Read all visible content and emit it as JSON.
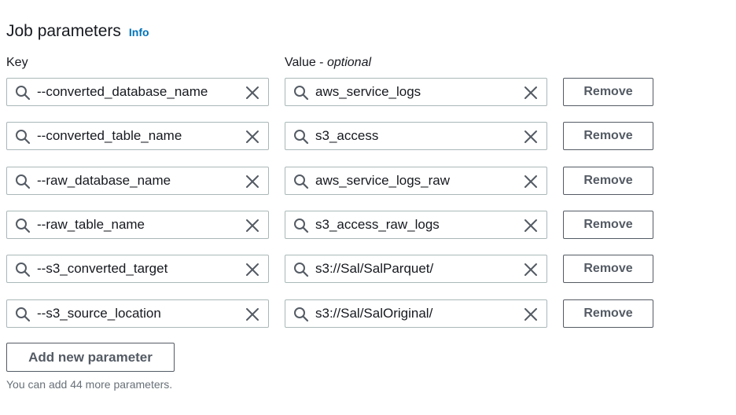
{
  "header": {
    "title": "Job parameters",
    "info_label": "Info"
  },
  "columns": {
    "key_label": "Key",
    "value_label": "Value -",
    "value_optional": "optional"
  },
  "parameters": [
    {
      "key": "--converted_database_name",
      "value": "aws_service_logs"
    },
    {
      "key": "--converted_table_name",
      "value": "s3_access"
    },
    {
      "key": "--raw_database_name",
      "value": "aws_service_logs_raw"
    },
    {
      "key": "--raw_table_name",
      "value": "s3_access_raw_logs"
    },
    {
      "key": "--s3_converted_target",
      "value": "s3://Sal/SalParquet/"
    },
    {
      "key": "--s3_source_location",
      "value": "s3://Sal/SalOriginal/"
    }
  ],
  "remove_label": "Remove",
  "add_button_label": "Add new parameter",
  "hint_text": "You can add 44 more parameters.",
  "icons": {
    "field_left": "search-icon",
    "field_right": "close-icon"
  },
  "colors": {
    "link": "#0073bb",
    "button_text": "#545b64",
    "field_border": "#aab7b8",
    "hint": "#687078"
  }
}
